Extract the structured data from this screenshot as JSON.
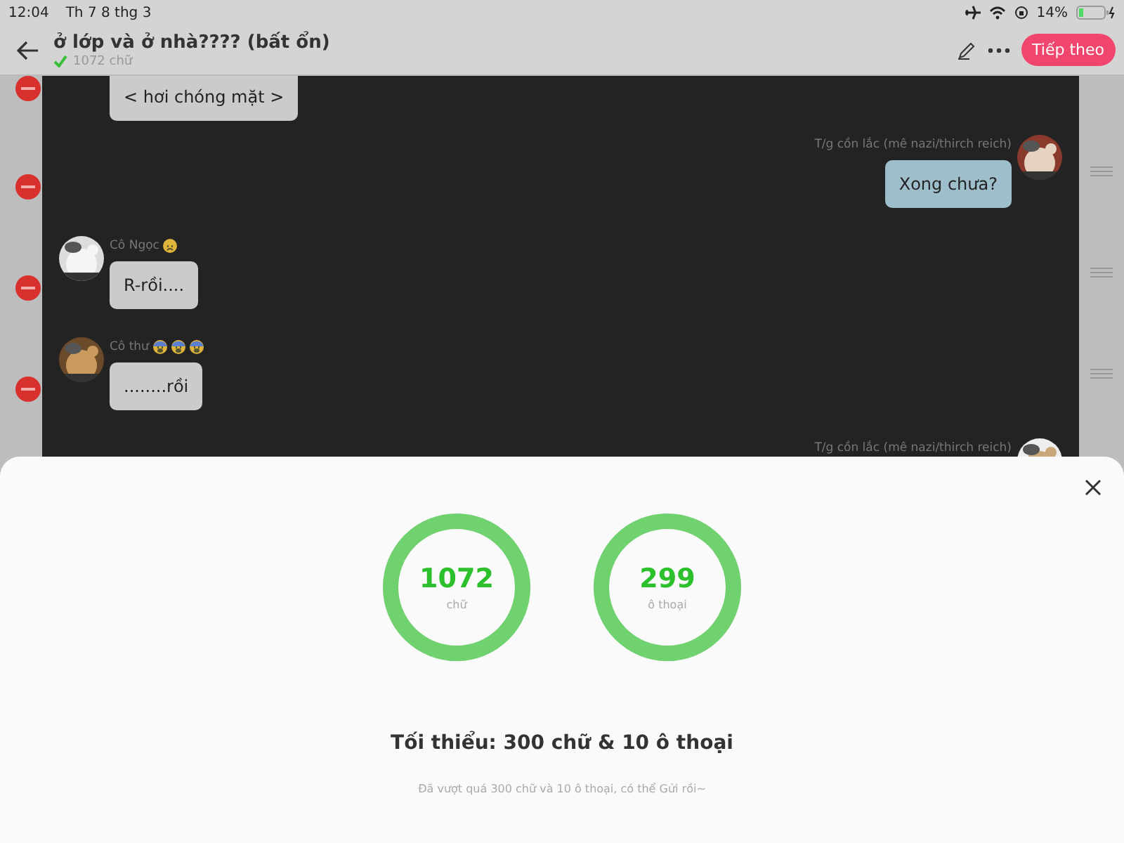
{
  "status_bar": {
    "time": "12:04",
    "date": "Th 7 8 thg 3",
    "battery": "14%"
  },
  "header": {
    "title": "ở lớp và ở nhà???? (bất ổn)",
    "word_count": "1072 chữ",
    "saved": true,
    "next_button": "Tiếp theo"
  },
  "messages": [
    {
      "kind": "incoming",
      "text": "< hơi chóng mặt >",
      "highlight": false
    },
    {
      "kind": "outgoing",
      "sender": "T/g cồn lắc (mê nazi/thirch reich)",
      "text": "Xong chưa?",
      "highlight": true
    },
    {
      "kind": "incoming",
      "sender": "Cô Ngọc",
      "emojis": [
        {
          "kind": "worried"
        }
      ],
      "text": "R-rồi....",
      "highlight": false
    },
    {
      "kind": "incoming",
      "sender": "Cô thư",
      "emojis": [
        {
          "kind": "fearful"
        },
        {
          "kind": "fearful"
        },
        {
          "kind": "fearful"
        }
      ],
      "text": "........rồi",
      "highlight": false
    },
    {
      "kind": "outgoing",
      "sender": "T/g cồn lắc (mê nazi/thirch reich)"
    }
  ],
  "sheet": {
    "gauges": [
      {
        "value": "1072",
        "unit": "chữ",
        "level": 1
      },
      {
        "value": "299",
        "unit": "ô thoại",
        "level": 1
      }
    ],
    "minimum": "Tối thiểu: 300 chữ & 10 ô thoại",
    "note": "Đã vượt quá 300 chữ và 10 ô thoại, có thể Gửi rồi~"
  }
}
